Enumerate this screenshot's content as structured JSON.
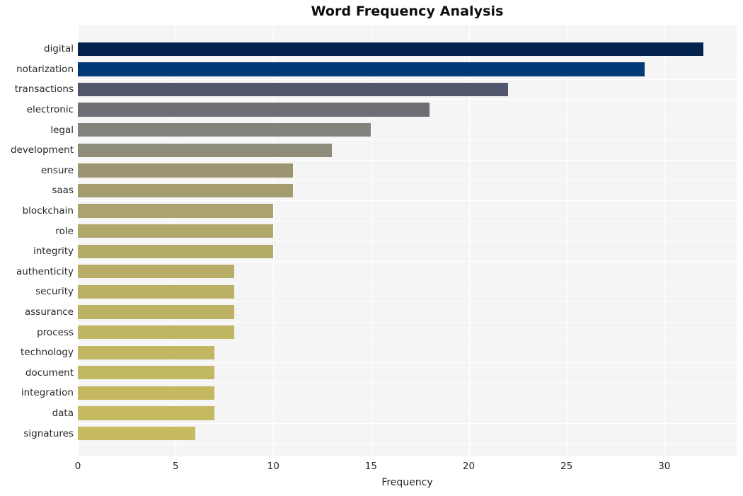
{
  "chart_data": {
    "type": "bar",
    "orientation": "horizontal",
    "title": "Word Frequency Analysis",
    "xlabel": "Frequency",
    "ylabel": "",
    "grid": true,
    "legend": null,
    "xlim": [
      0,
      33.7
    ],
    "xticks": [
      0,
      5,
      10,
      15,
      20,
      25,
      30
    ],
    "xtick_labels": [
      "0",
      "5",
      "10",
      "15",
      "20",
      "25",
      "30"
    ],
    "categories": [
      "digital",
      "notarization",
      "transactions",
      "electronic",
      "legal",
      "development",
      "ensure",
      "saas",
      "blockchain",
      "role",
      "integrity",
      "authenticity",
      "security",
      "assurance",
      "process",
      "technology",
      "document",
      "integration",
      "data",
      "signatures"
    ],
    "values": [
      32,
      29,
      22,
      18,
      15,
      13,
      11,
      11,
      10,
      10,
      10,
      8,
      8,
      8,
      8,
      7,
      7,
      7,
      7,
      6
    ],
    "bar_colors": [
      "#04244e",
      "#023a77",
      "#53576e",
      "#6e6f75",
      "#84827d",
      "#8e8b78",
      "#9b9572",
      "#a49c6f",
      "#aaa36d",
      "#b0a76b",
      "#b4ab69",
      "#b8ae67",
      "#bbb165",
      "#bdb364",
      "#bfb563",
      "#c1b662",
      "#c2b861",
      "#c4b960",
      "#c5ba5f",
      "#c6bb5e"
    ],
    "plot_background": "#f5f5f6",
    "grid_color": "#ffffff",
    "page_background": "#ffffff"
  }
}
